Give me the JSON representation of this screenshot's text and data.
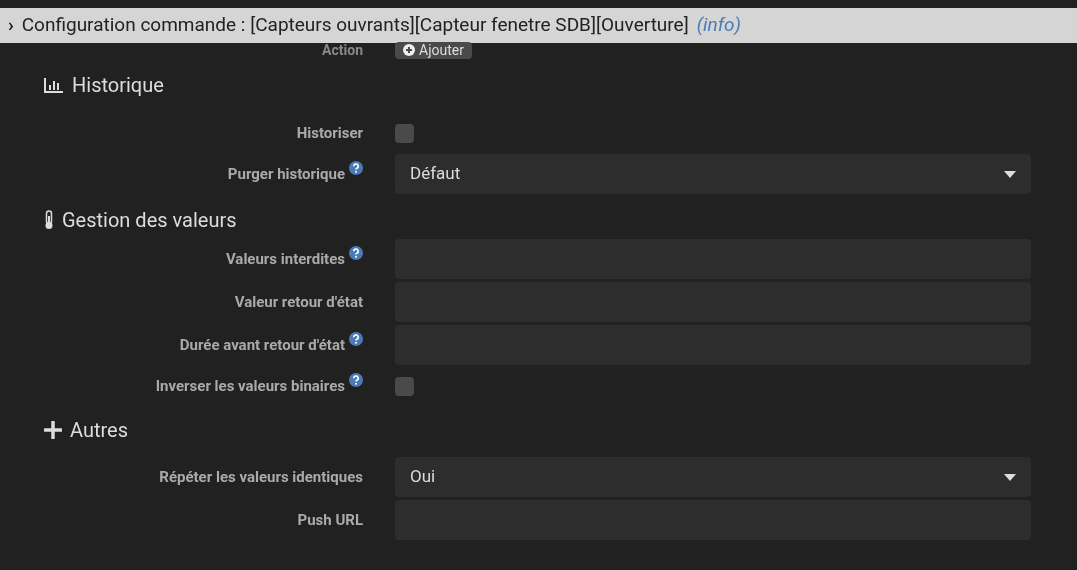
{
  "header": {
    "expander": "›",
    "title": "Configuration commande : [Capteurs ouvrants][Capteur fenetre SDB][Ouverture]",
    "info": "(info)"
  },
  "action_row": {
    "label": "Action",
    "button": "Ajouter"
  },
  "sections": [
    {
      "title": "Historique",
      "rows": [
        {
          "kind": "checkbox",
          "label": "Historiser",
          "help": false,
          "checked": false
        },
        {
          "kind": "select",
          "label": "Purger historique",
          "help": true,
          "value": "Défaut"
        }
      ]
    },
    {
      "title": "Gestion des valeurs",
      "rows": [
        {
          "kind": "input",
          "label": "Valeurs interdites",
          "help": true
        },
        {
          "kind": "input",
          "label": "Valeur retour d'état",
          "help": false
        },
        {
          "kind": "input",
          "label": "Durée avant retour d'état",
          "help": true
        },
        {
          "kind": "checkbox",
          "label": "Inverser les valeurs binaires",
          "help": true,
          "checked": false
        }
      ]
    },
    {
      "title": "Autres",
      "rows": [
        {
          "kind": "select",
          "label": "Répéter les valeurs identiques",
          "help": false,
          "value": "Oui"
        },
        {
          "kind": "input",
          "label": "Push URL",
          "help": false
        }
      ]
    }
  ]
}
